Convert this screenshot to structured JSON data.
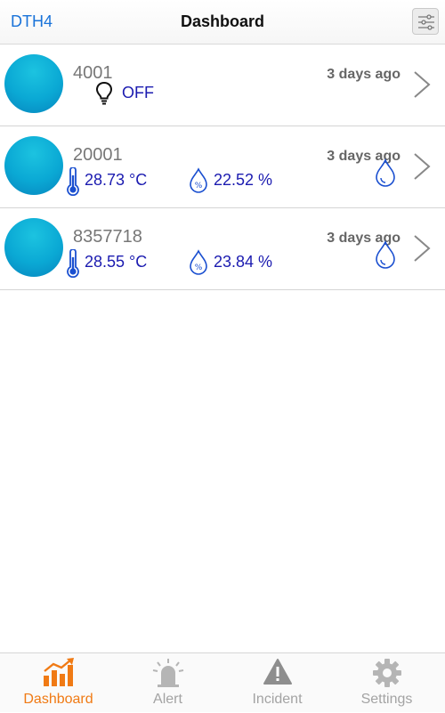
{
  "header": {
    "back_label": "DTH4",
    "title": "Dashboard",
    "filter_icon": "sliders-icon"
  },
  "devices": [
    {
      "id": "4001",
      "time": "3 days ago",
      "type": "light",
      "status": "OFF"
    },
    {
      "id": "20001",
      "time": "3 days ago",
      "type": "sensor",
      "temperature": "28.73 °C",
      "humidity": "22.52 %"
    },
    {
      "id": "8357718",
      "time": "3 days ago",
      "type": "sensor",
      "temperature": "28.55 °C",
      "humidity": "23.84 %"
    }
  ],
  "tabs": [
    {
      "label": "Dashboard",
      "icon": "bar-chart-trend-icon",
      "active": true
    },
    {
      "label": "Alert",
      "icon": "siren-icon",
      "active": false
    },
    {
      "label": "Incident",
      "icon": "warning-triangle-icon",
      "active": false
    },
    {
      "label": "Settings",
      "icon": "gear-icon",
      "active": false
    }
  ],
  "colors": {
    "accent_blue": "#1a73d9",
    "reading_blue": "#1b1bb0",
    "avatar_cyan": "#0aa8d4",
    "active_tab": "#f07a14",
    "inactive_tab": "#a3a3a3"
  }
}
